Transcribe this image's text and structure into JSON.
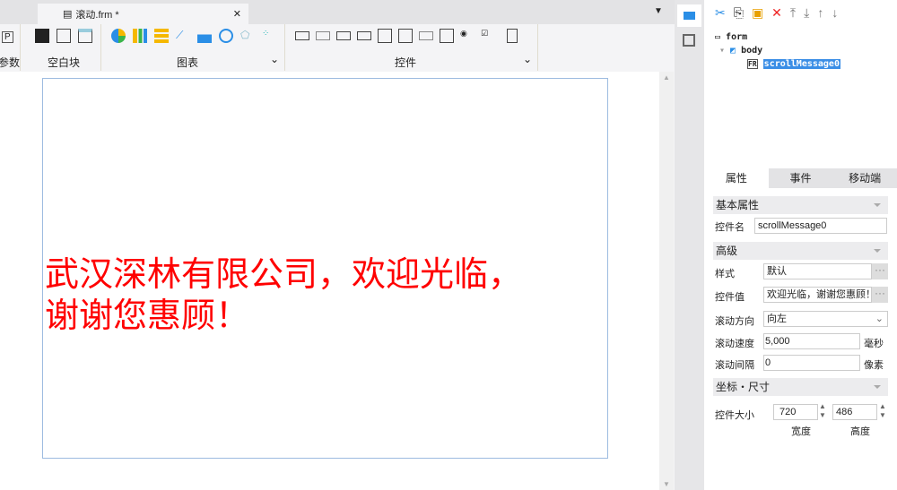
{
  "tabs": {
    "file_tab": "滚动.frm *"
  },
  "ribbon": {
    "groups": [
      {
        "label": "参数"
      },
      {
        "label": "空白块"
      },
      {
        "label": "图表"
      },
      {
        "label": "控件"
      }
    ]
  },
  "canvas": {
    "message": "武汉深林有限公司，欢迎光临，谢谢您惠顾！"
  },
  "tree": {
    "root": "form",
    "body": "body",
    "selected": "scrollMessage0"
  },
  "props": {
    "tabs": [
      "属性",
      "事件",
      "移动端"
    ],
    "basic": "基本属性",
    "name_label": "控件名",
    "name_value": "scrollMessage0",
    "advanced": "高级",
    "style_label": "样式",
    "style_value": "默认",
    "value_label": "控件值",
    "value_value": "欢迎光临，谢谢您惠顾！",
    "dir_label": "滚动方向",
    "dir_value": "向左",
    "speed_label": "滚动速度",
    "speed_value": "5,000",
    "speed_unit": "毫秒",
    "gap_label": "滚动间隔",
    "gap_value": "0",
    "gap_unit": "像素",
    "coord": "坐标・尺寸",
    "size_label": "控件大小",
    "width_value": "720",
    "height_value": "486",
    "width_label": "宽度",
    "height_label": "高度"
  }
}
